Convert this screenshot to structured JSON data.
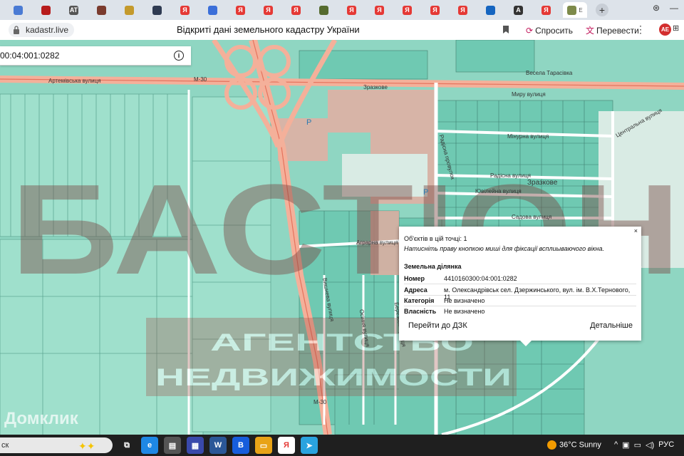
{
  "browser": {
    "tabs": [
      {
        "icon": "blue-square-icon",
        "color": "#4a7bd4",
        "label": ""
      },
      {
        "icon": "red-globe-icon",
        "color": "#b71c1c",
        "label": ""
      },
      {
        "icon": "at-icon",
        "color": "#555555",
        "label": "AT"
      },
      {
        "icon": "shield-emblem-icon",
        "color": "#7a3b2e",
        "label": ""
      },
      {
        "icon": "eagle-emblem-icon",
        "color": "#c49a2c",
        "label": ""
      },
      {
        "icon": "dark-window-icon",
        "color": "#2f3b52",
        "label": ""
      },
      {
        "icon": "yandex-icon",
        "color": "#e53935",
        "label": "Я"
      },
      {
        "icon": "flag-icon",
        "color": "#3b6fd9",
        "label": ""
      },
      {
        "icon": "yandex-icon",
        "color": "#e53935",
        "label": "Я"
      },
      {
        "icon": "yandex-icon",
        "color": "#e53935",
        "label": "Я"
      },
      {
        "icon": "yandex-icon",
        "color": "#e53935",
        "label": "Я"
      },
      {
        "icon": "emblem-icon",
        "color": "#556b2f",
        "label": ""
      },
      {
        "icon": "yandex-icon",
        "color": "#e53935",
        "label": "Я"
      },
      {
        "icon": "yandex-icon",
        "color": "#e53935",
        "label": "Я"
      },
      {
        "icon": "yandex-icon",
        "color": "#e53935",
        "label": "Я"
      },
      {
        "icon": "yandex-icon",
        "color": "#e53935",
        "label": "Я"
      },
      {
        "icon": "yandex-icon",
        "color": "#e53935",
        "label": "Я"
      },
      {
        "icon": "blue-app-icon",
        "color": "#1565c0",
        "label": ""
      },
      {
        "icon": "letter-a-icon",
        "color": "#333333",
        "label": "A"
      },
      {
        "icon": "yandex-icon",
        "color": "#e53935",
        "label": "Я"
      }
    ],
    "active_tab_label": "E",
    "url": "kadastr.live",
    "page_title": "Відкриті дані земельного кадастру України",
    "ask_label": "Спросить",
    "translate_label": "Перевести",
    "avatar_label": "AE"
  },
  "map": {
    "search_value": "00:04:001:0282",
    "labels": {
      "artemivska": "Артемівська вулиця",
      "m30_top": "М-30",
      "m30_bottom": "М-30",
      "zrazkove1": "Зразкове",
      "zrazkove2": "Зразкове",
      "vesela": "Весела Тарасівка",
      "myru": "Миру вулиця",
      "minurna": "Мінурна вулиця",
      "tsentralna": "Центральна вулиця",
      "radisna_v": "Радісна провулок",
      "radisna": "Радісна вулиця",
      "yuvileina": "Ювілейна вулиця",
      "sadova": "Садова вулиця",
      "agrarna": "Аграрна вулиця",
      "vyshneva": "Вишнева вулиця",
      "osinnya": "Осіння вулиця",
      "berezova": "Березова вулиця",
      "parking1": "P",
      "parking2": "P"
    },
    "watermark_main": "БАСТІОН",
    "watermark_sub1": "АГЕНТСТВО",
    "watermark_sub2": "НЕДВИЖИМОСТИ",
    "domklik": "Домклик"
  },
  "popup": {
    "close": "×",
    "objects_label": "Об'єктів в цій точці: 1",
    "hint": "Натисніть праву кнопкою миші для фіксації всплиываючого вікна.",
    "section": "Земельна ділянка",
    "rows": [
      {
        "key": "Номер",
        "value": "4410160300:04:001:0282"
      },
      {
        "key": "Адреса",
        "value": "м. Олександрівськ сел. Дзержинського, вул. ім. В.Х.Тернового, 11"
      },
      {
        "key": "Категорія",
        "value": "Не визначено"
      },
      {
        "key": "Власність",
        "value": "Не визначено"
      }
    ],
    "btn_dzk": "Перейти до ДЗК",
    "btn_details": "Детальніше"
  },
  "taskbar": {
    "search_text": "ск",
    "weather": "36°C  Sunny",
    "lang": "РУС",
    "icons": [
      {
        "name": "task-view-icon",
        "color": "#1f1f1f",
        "label": "⧉"
      },
      {
        "name": "edge-icon",
        "color": "#1e88e5",
        "label": "e"
      },
      {
        "name": "scanner-icon",
        "color": "#555555",
        "label": "▤"
      },
      {
        "name": "calculator-icon",
        "color": "#3949ab",
        "label": "▦"
      },
      {
        "name": "word-icon",
        "color": "#2b5797",
        "label": "W"
      },
      {
        "name": "bitwarden-icon",
        "color": "#175ddc",
        "label": "B"
      },
      {
        "name": "explorer-icon",
        "color": "#e8a317",
        "label": "▭"
      },
      {
        "name": "yandex-browser-icon",
        "color": "#ffffff",
        "label": "Я"
      },
      {
        "name": "telegram-icon",
        "color": "#2aa3df",
        "label": "➤"
      }
    ]
  }
}
